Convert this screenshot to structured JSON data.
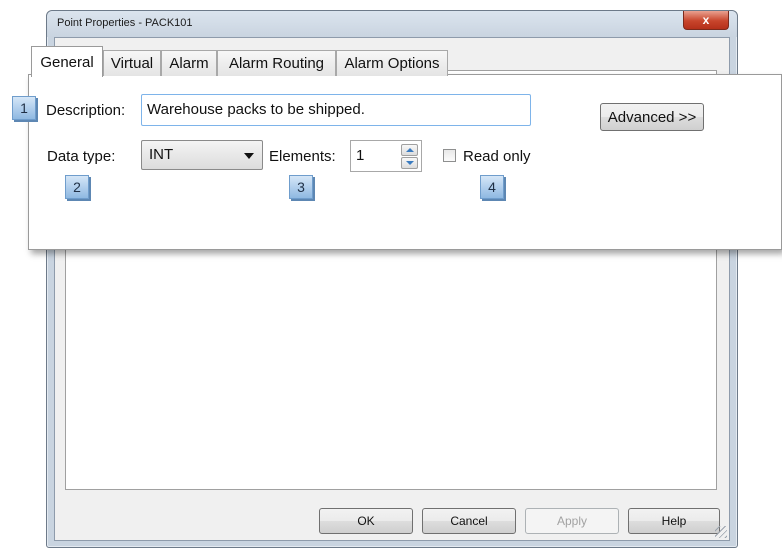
{
  "window": {
    "title": "Point Properties - PACK101",
    "close_glyph": "x"
  },
  "tabs": [
    {
      "label": "General",
      "active": true
    },
    {
      "label": "Virtual",
      "active": false
    },
    {
      "label": "Alarm",
      "active": false
    },
    {
      "label": "Alarm Routing",
      "active": false
    },
    {
      "label": "Alarm Options",
      "active": false
    }
  ],
  "form": {
    "description_label": "Description:",
    "description_value": "Warehouse packs to be shipped.",
    "advanced_label": "Advanced >>",
    "data_type_label": "Data type:",
    "data_type_value": "INT",
    "elements_label": "Elements:",
    "elements_value": "1",
    "read_only_label": "Read only",
    "read_only_checked": false
  },
  "markers": [
    "1",
    "2",
    "3",
    "4"
  ],
  "buttons": {
    "ok": "OK",
    "cancel": "Cancel",
    "apply": "Apply",
    "help": "Help"
  },
  "colors": {
    "marker_fill": "#8fb9e2",
    "close_button": "#c8452c",
    "focus_border": "#7eb4ea"
  }
}
